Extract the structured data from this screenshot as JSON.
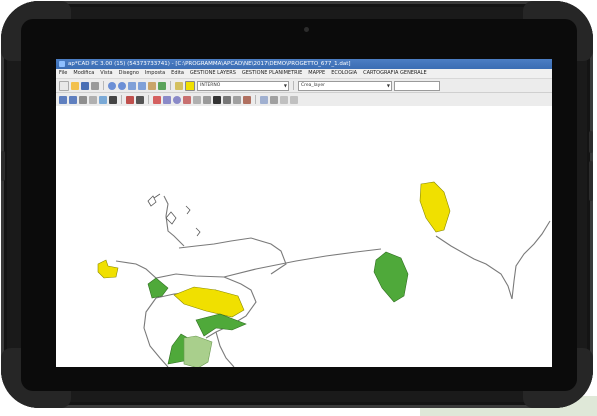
{
  "window": {
    "title": "ap*CAD PC 3.00 (15) (54373733741) - [C:\\PROGRAMMA\\APCAD\\NE\\2017\\DEMO\\PROGETTO_677_1.dat]"
  },
  "menu": [
    "File",
    "Modifica",
    "Vista",
    "Disegno",
    "Imposta",
    "Edita",
    "GESTIONE LAYERS",
    "GESTIONE PLANIMETRIE",
    "MAPPE",
    "ECOLOGIA",
    "CARTOGRAFIA GENERALE"
  ],
  "toolbar": {
    "layer_select_value": "INTERNO",
    "style_select_value": "Crea_layer"
  },
  "icons": {
    "toolbar_row1": [
      "new-file-icon",
      "open-folder-icon",
      "save-icon",
      "print-icon",
      "zoom-in-icon",
      "zoom-out-icon",
      "zoom-window-icon",
      "zoom-all-icon",
      "pan-icon",
      "refresh-icon",
      "layer-icon",
      "color-icon"
    ],
    "toolbar_row2": [
      "grid-icon",
      "snap-icon",
      "ortho-icon",
      "table-icon",
      "export-icon",
      "import-icon",
      "select-icon",
      "cursor-icon",
      "line-icon",
      "polyline-icon",
      "circle-icon",
      "arc-icon",
      "rotate-icon",
      "move-icon",
      "text-icon",
      "measure-icon",
      "area-icon",
      "node-icon",
      "pencil-icon",
      "erase-icon"
    ]
  },
  "colors": {
    "device_frame": "#1a1a1a",
    "titlebar": "#3b6db3",
    "polygon_yellow": "#f0e000",
    "polygon_green": "#4fa93a",
    "polygon_light_green": "#a9cf8c",
    "boundary_line": "#7a7a7a"
  }
}
